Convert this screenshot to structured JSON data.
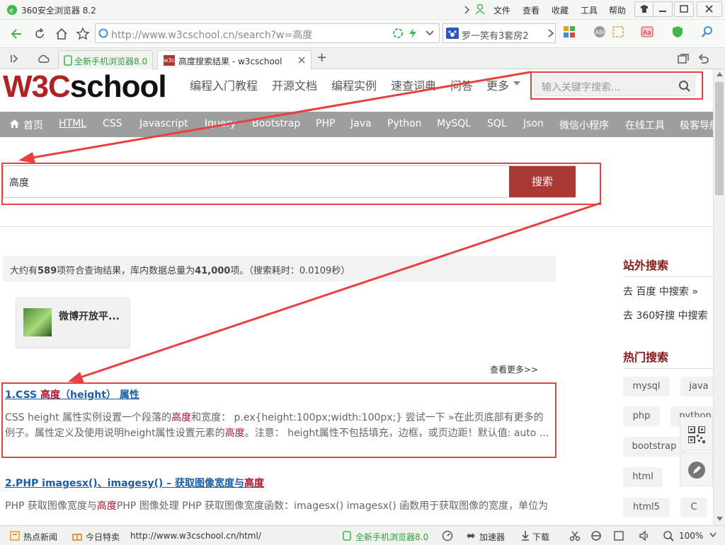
{
  "browser": {
    "title": "360安全浏览器 8.2",
    "menu": [
      "文件",
      "查看",
      "收藏",
      "工具",
      "帮助"
    ],
    "url": "http://www.w3cschool.cn/search?w=高度",
    "search_engine_text": "罗一笑有3套房2",
    "tabs": [
      {
        "label": "全新手机浏览器8.0"
      },
      {
        "label": "高度搜索结果 - w3cschool"
      }
    ],
    "favicon_text": "w3c",
    "new_tab_label": "+"
  },
  "site": {
    "logo_w3c": "W3C",
    "logo_school": "school",
    "topnav": [
      "编程入门教程",
      "开源文档",
      "编程实例",
      "速查词典",
      "问答",
      "更多"
    ],
    "search_placeholder": "输入关键字搜索...",
    "navbar": [
      "首页",
      "HTML",
      "CSS",
      "Javascript",
      "Jquery",
      "Bootstrap",
      "PHP",
      "Java",
      "Python",
      "MySQL",
      "SQL",
      "Json",
      "微信小程序",
      "在线工具",
      "极客导航"
    ]
  },
  "search": {
    "query": "高度",
    "button": "搜索"
  },
  "stats": {
    "prefix": "大约有",
    "count": "589",
    "middle": "项符合查询结果，库内数据总量为",
    "total": "41,000",
    "suffix": "项。（搜索耗时：0.0109秒）"
  },
  "promo": {
    "label": "微博开放平..."
  },
  "more_link": "查看更多>>",
  "results": [
    {
      "title_pre": "1.CSS ",
      "title_hl": "高度",
      "title_post": "（height） 属性",
      "desc_1": "CSS height 属性实例设置一个段落的",
      "desc_hl1": "高度",
      "desc_2": "和宽度： p.ex{height:100px;width:100px;} 尝试一下 »在此页底部有更多的例子。属性定义及使用说明height属性设置元素的",
      "desc_hl2": "高度",
      "desc_3": "。注意： height属性不包括填充，边框，或页边距！默认值: auto ..."
    },
    {
      "title_pre": "2.PHP imagesx()、imagesy() – 获取图像宽度与",
      "title_hl": "高度",
      "desc_1": "PHP 获取图像宽度与",
      "desc_hl1": "高度",
      "desc_2": "PHP 图像处理 PHP 获取图像宽度函数：imagesx() imagesx() 函数用于获取图像的宽度，单位为"
    }
  ],
  "sidebar": {
    "external_heading": "站外搜索",
    "external_links": [
      "去 百度 中搜索 »",
      "去 360好搜 中搜索"
    ],
    "hot_heading": "热门搜索",
    "tags": [
      "mysql",
      "java",
      "php",
      "python",
      "bootstrap",
      "html",
      "html5",
      "C"
    ]
  },
  "statusbar": {
    "news": "热点新闻",
    "deals": "今日特卖",
    "hover_url": "http://www.w3cschool.cn/html/",
    "promo": "全新手机浏览器8.0",
    "accelerator": "加速器",
    "download": "下载",
    "zoom": "100%"
  },
  "colors": {
    "accent_red": "#b22222",
    "button_red": "#a83a33",
    "annotation_red": "#e84040",
    "link_blue": "#1a5ea8",
    "navbar_gray": "#9e9e9e"
  }
}
